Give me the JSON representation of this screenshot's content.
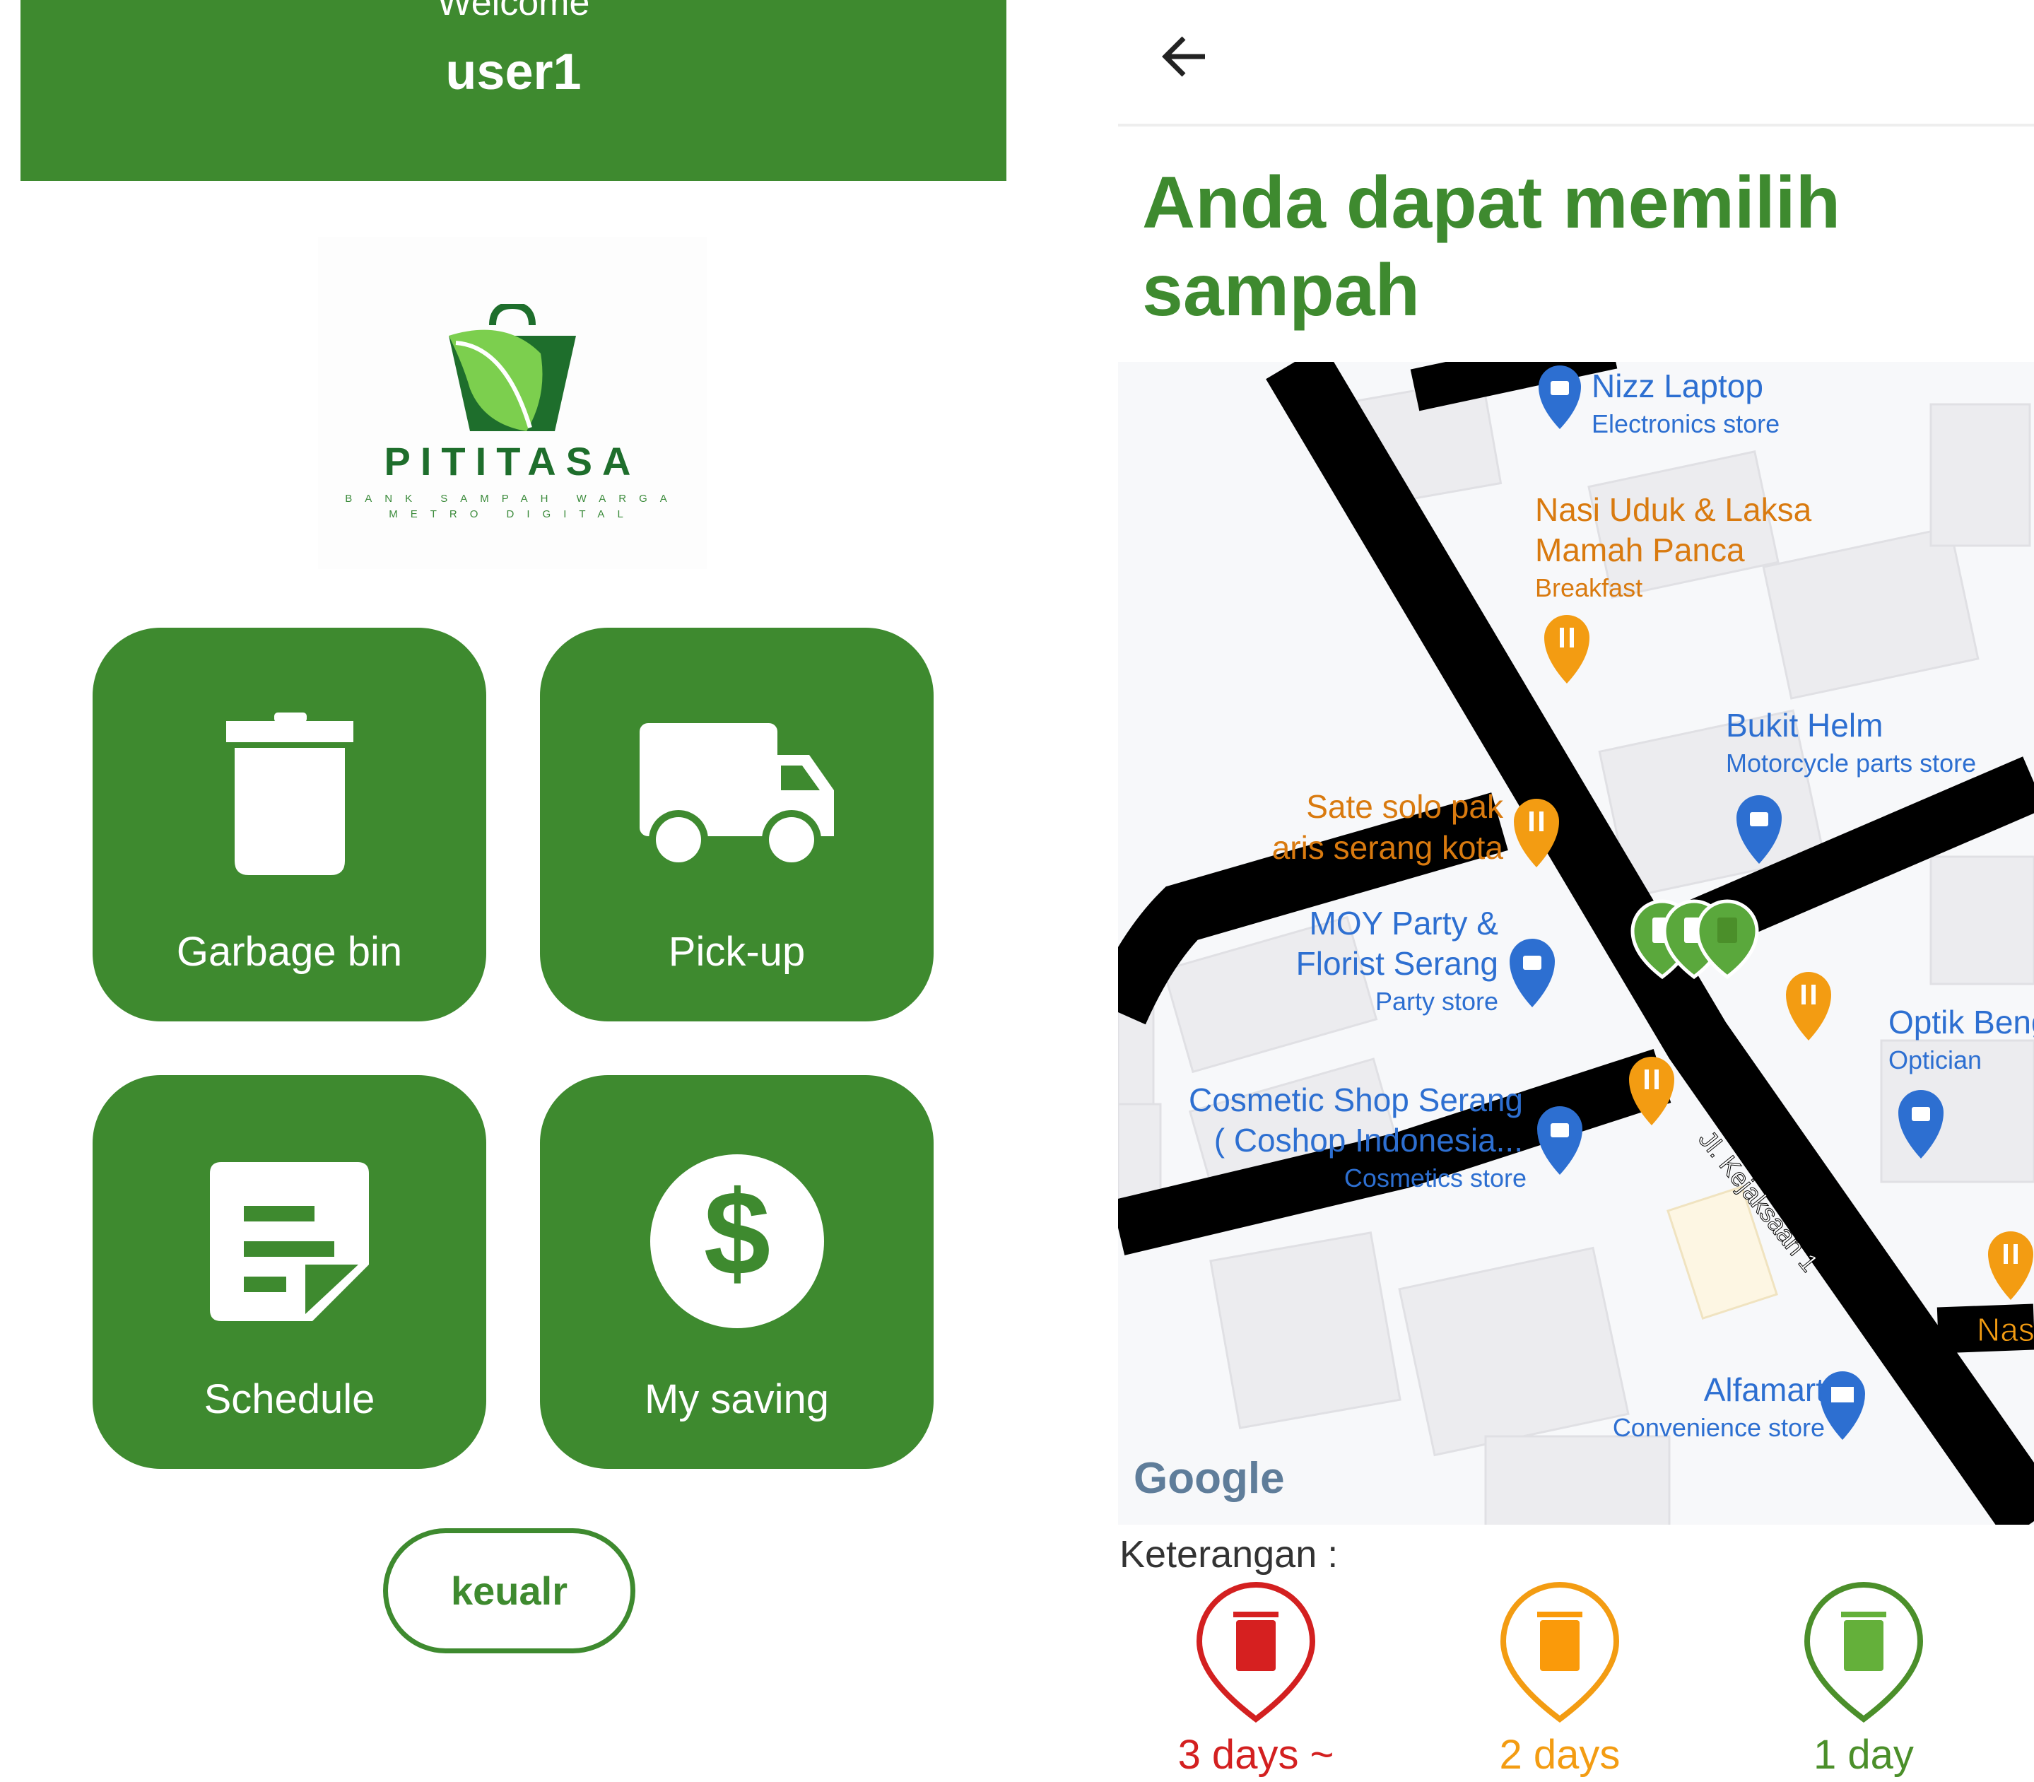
{
  "home": {
    "welcome_text": "Welcome",
    "username": "user1",
    "logo": {
      "name": "PITITASA",
      "tagline_line1": "BANK SAMPAH WARGA",
      "tagline_line2": "METRO DIGITAL"
    },
    "tiles": [
      {
        "label": "Garbage bin",
        "icon": "trash-icon"
      },
      {
        "label": "Pick-up",
        "icon": "truck-icon"
      },
      {
        "label": "Schedule",
        "icon": "note-icon"
      },
      {
        "label": "My saving",
        "icon": "dollar-icon"
      }
    ],
    "logout_label": "keualr"
  },
  "map_screen": {
    "back_icon": "arrow-left-icon",
    "title": "Anda dapat memilih sampah",
    "map": {
      "provider_logo": "Google",
      "street_label": "Jl. Kejaksaan 1",
      "pois": [
        {
          "name": "Nizz Laptop",
          "category": "Electronics store",
          "type": "shopping"
        },
        {
          "name_line1": "Nasi Uduk & Laksa",
          "name_line2": "Mamah Panca",
          "category": "Breakfast",
          "type": "restaurant"
        },
        {
          "name": "Bukit Helm",
          "category": "Motorcycle parts store",
          "type": "shopping"
        },
        {
          "name_line1": "Sate solo pak",
          "name_line2": "aris serang kota",
          "type": "restaurant"
        },
        {
          "name_line1": "MOY Party &",
          "name_line2": "Florist Serang",
          "category": "Party store",
          "type": "shopping"
        },
        {
          "name": "Optik Beng",
          "category": "Optician",
          "type": "shopping"
        },
        {
          "name_line1": "Cosmetic Shop Serang",
          "name_line2": "( Coshop Indonesia...",
          "category": "Cosmetics store",
          "type": "shopping"
        },
        {
          "name": "Alfamart",
          "category": "Convenience store",
          "type": "store"
        },
        {
          "name": "Nas",
          "type": "restaurant"
        }
      ]
    },
    "legend": {
      "title": "Keterangan :",
      "items": [
        {
          "label": "3 days ~",
          "color": "#d32020",
          "fill": "#d62020"
        },
        {
          "label": "2 days",
          "color": "#f39c12",
          "fill": "#fa9a0a"
        },
        {
          "label": "1 day",
          "color": "#4b8f2a",
          "fill": "#64b03a"
        }
      ]
    }
  },
  "colors": {
    "primary_green": "#3e8a2f",
    "poi_blue": "#2d6fd1",
    "poi_orange": "#d97a0f"
  }
}
